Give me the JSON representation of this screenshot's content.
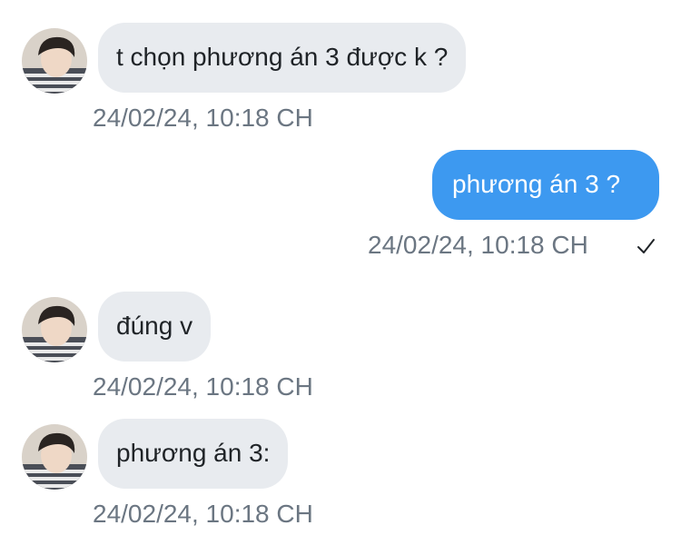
{
  "colors": {
    "incoming_bubble": "#e8ebef",
    "outgoing_bubble": "#3d99f0",
    "timestamp": "#6b7682",
    "text_dark": "#1f2327"
  },
  "messages": [
    {
      "direction": "incoming",
      "text": "t chọn phương án 3 được k ?",
      "timestamp": "24/02/24, 10:18 CH",
      "avatar": "contact-avatar"
    },
    {
      "direction": "outgoing",
      "text": "phương án 3 ?",
      "timestamp": "24/02/24, 10:18 CH",
      "status_icon": "check-icon"
    },
    {
      "direction": "incoming",
      "text": "đúng v",
      "timestamp": "24/02/24, 10:18 CH",
      "avatar": "contact-avatar"
    },
    {
      "direction": "incoming",
      "text": "phương án 3:",
      "timestamp": "24/02/24, 10:18 CH",
      "avatar": "contact-avatar"
    }
  ]
}
